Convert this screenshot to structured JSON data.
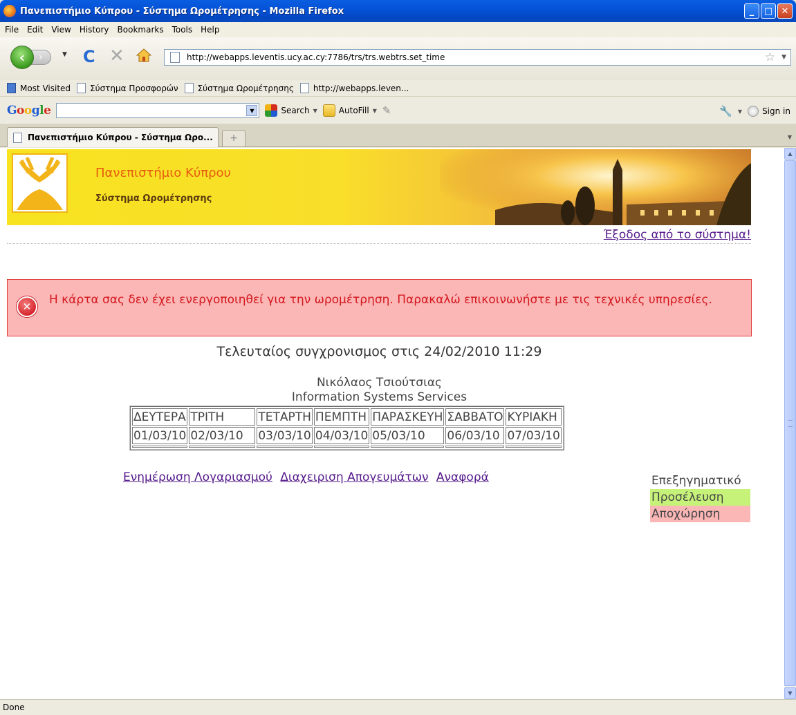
{
  "window": {
    "title": "Πανεπιστήμιο Κύπρου - Σύστημα Ωρομέτρησης - Mozilla Firefox"
  },
  "menu": {
    "items": [
      "File",
      "Edit",
      "View",
      "History",
      "Bookmarks",
      "Tools",
      "Help"
    ]
  },
  "nav": {
    "url": "http://webapps.leventis.ucy.ac.cy:7786/trs/trs.webtrs.set_time"
  },
  "bookmarks": {
    "items": [
      "Most Visited",
      "Σύστημα Προσφορών",
      "Σύστημα Ωρομέτρησης",
      "http://webapps.leven..."
    ]
  },
  "google_toolbar": {
    "logo": "Google",
    "search_label": "Search",
    "autofill_label": "AutoFill",
    "signin_label": "Sign in"
  },
  "tabs": {
    "active_label": "Πανεπιστήμιο Κύπρου - Σύστημα Ωρο...",
    "new_tab_glyph": "+"
  },
  "page": {
    "university_name": "Πανεπιστήμιο Κύπρου",
    "system_name": "Σύστημα Ωρομέτρησης",
    "logout_link": "Έξοδος από το σύστημα!",
    "error_message": "Η κάρτα σας δεν έχει ενεργοποιηθεί για την ωρομέτρηση. Παρακαλώ επικοινωνήστε με τις τεχνικές υπηρεσίες.",
    "last_sync": "Τελευταίος συγχρονισμος στις 24/02/2010 11:29",
    "person_name": "Νικόλαος Τσιούτσιας",
    "department": "Information Systems Services",
    "calendar": {
      "days": [
        "ΔΕΥΤΕΡΑ",
        "ΤΡΙΤΗ",
        "ΤΕΤΑΡΤΗ",
        "ΠΕΜΠΤΗ",
        "ΠΑΡΑΣΚΕΥΗ",
        "ΣΑΒΒΑΤΟ",
        "ΚΥΡΙΑΚΗ"
      ],
      "dates": [
        "01/03/10",
        "02/03/10",
        "03/03/10",
        "04/03/10",
        "05/03/10",
        "06/03/10",
        "07/03/10"
      ]
    },
    "links": [
      "Ενημέρωση Λογαριασμού",
      "Διαχειριση Απογευμάτων",
      "Αναφορά"
    ],
    "legend": {
      "title": "Επεξηγηματικό",
      "arrival": "Προσέλευση",
      "departure": "Αποχώρηση",
      "arrival_color": "#C6F27A",
      "departure_color": "#FBB6B6"
    }
  },
  "status": {
    "text": "Done"
  },
  "colors": {
    "titlebar": "#0553D8",
    "error_text": "#D4181E",
    "link": "#551A8B",
    "banner_accent": "#E65B10"
  }
}
